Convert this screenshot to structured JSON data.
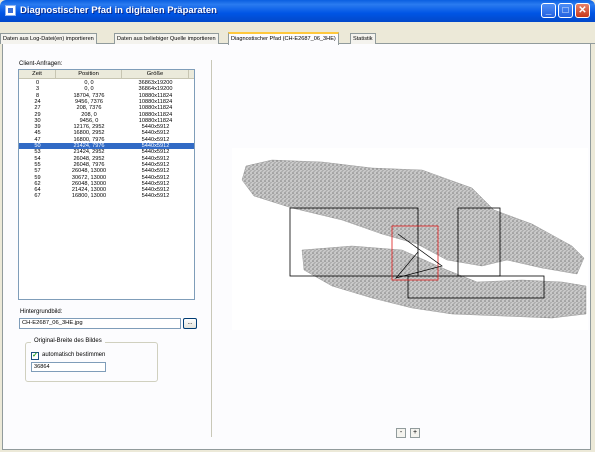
{
  "window": {
    "title": "Diagnostischer Pfad in digitalen Präparaten",
    "minimize": "_",
    "maximize": "□",
    "close": "✕"
  },
  "tabs": [
    {
      "label": "Daten aus Log-Datei(en) importieren"
    },
    {
      "label": "Daten aus beliebiger Quelle importieren"
    },
    {
      "label": "Diagnostischer Pfad (CH-E2687_06_3HE)",
      "active": true
    },
    {
      "label": "Statistik"
    }
  ],
  "client_list": {
    "label": "Client-Anfragen:",
    "columns": [
      "Zeit",
      "Position",
      "Größe"
    ],
    "selected_index": 10,
    "rows": [
      {
        "zeit": "0",
        "position": "0, 0",
        "groesse": "36863x19200"
      },
      {
        "zeit": "3",
        "position": "0, 0",
        "groesse": "36864x19200"
      },
      {
        "zeit": "8",
        "position": "18704, 7376",
        "groesse": "10880x11824"
      },
      {
        "zeit": "24",
        "position": "9456, 7376",
        "groesse": "10880x11824"
      },
      {
        "zeit": "27",
        "position": "208, 7376",
        "groesse": "10880x11824"
      },
      {
        "zeit": "29",
        "position": "208, 0",
        "groesse": "10880x11824"
      },
      {
        "zeit": "30",
        "position": "9456, 0",
        "groesse": "10880x11824"
      },
      {
        "zeit": "39",
        "position": "12176, 2952",
        "groesse": "5440x5912"
      },
      {
        "zeit": "45",
        "position": "16800, 2952",
        "groesse": "5440x5912"
      },
      {
        "zeit": "47",
        "position": "16800, 7976",
        "groesse": "5440x5912"
      },
      {
        "zeit": "50",
        "position": "21424, 7976",
        "groesse": "5440x5912"
      },
      {
        "zeit": "53",
        "position": "21424, 2952",
        "groesse": "5440x5912"
      },
      {
        "zeit": "54",
        "position": "26048, 2952",
        "groesse": "5440x5912"
      },
      {
        "zeit": "55",
        "position": "26048, 7976",
        "groesse": "5440x5912"
      },
      {
        "zeit": "57",
        "position": "26048, 13000",
        "groesse": "5440x5912"
      },
      {
        "zeit": "59",
        "position": "30672, 13000",
        "groesse": "5440x5912"
      },
      {
        "zeit": "62",
        "position": "26048, 13000",
        "groesse": "5440x5912"
      },
      {
        "zeit": "64",
        "position": "21424, 13000",
        "groesse": "5440x5912"
      },
      {
        "zeit": "67",
        "position": "16800, 13000",
        "groesse": "5440x5912"
      }
    ]
  },
  "background_image": {
    "label": "Hintergrundbild:",
    "value": "CH-E2687_06_3HE.jpg",
    "browse_label": "..."
  },
  "original_width": {
    "group_title": "Original-Breite des Bildes",
    "checkbox_label": "automatisch bestimmen",
    "checked": true,
    "value": "36864"
  },
  "navigation": {
    "prev": "-",
    "next": "+"
  },
  "colors": {
    "titlebar": "#0055e5",
    "selection": "#316ac5",
    "highlight_region": "#e03030"
  }
}
